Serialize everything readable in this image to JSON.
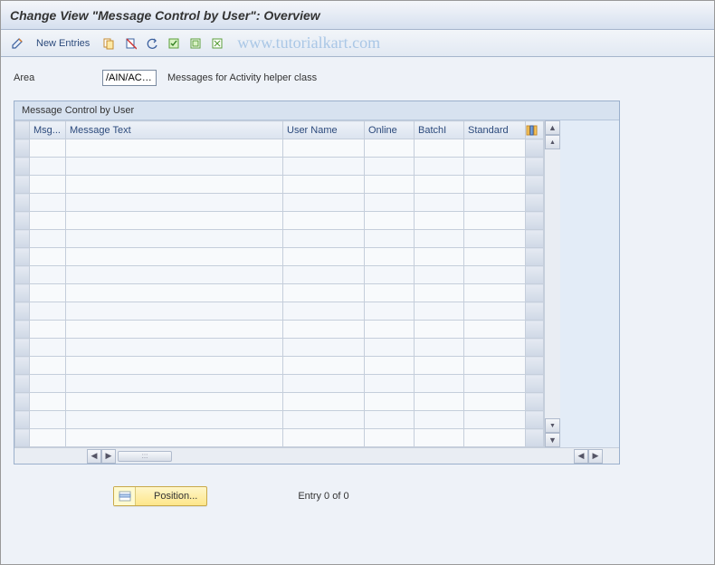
{
  "title": "Change View \"Message Control by User\": Overview",
  "watermark": "www.tutorialkart.com",
  "toolbar": {
    "new_entries": "New Entries"
  },
  "area": {
    "label": "Area",
    "value": "/AIN/AC…",
    "description": "Messages for Activity helper class"
  },
  "panel": {
    "title": "Message Control by User",
    "columns": {
      "msg": "Msg...",
      "text": "Message Text",
      "user": "User Name",
      "online": "Online",
      "batch": "BatchI",
      "standard": "Standard"
    }
  },
  "footer": {
    "position": "Position...",
    "entry": "Entry 0 of 0"
  }
}
